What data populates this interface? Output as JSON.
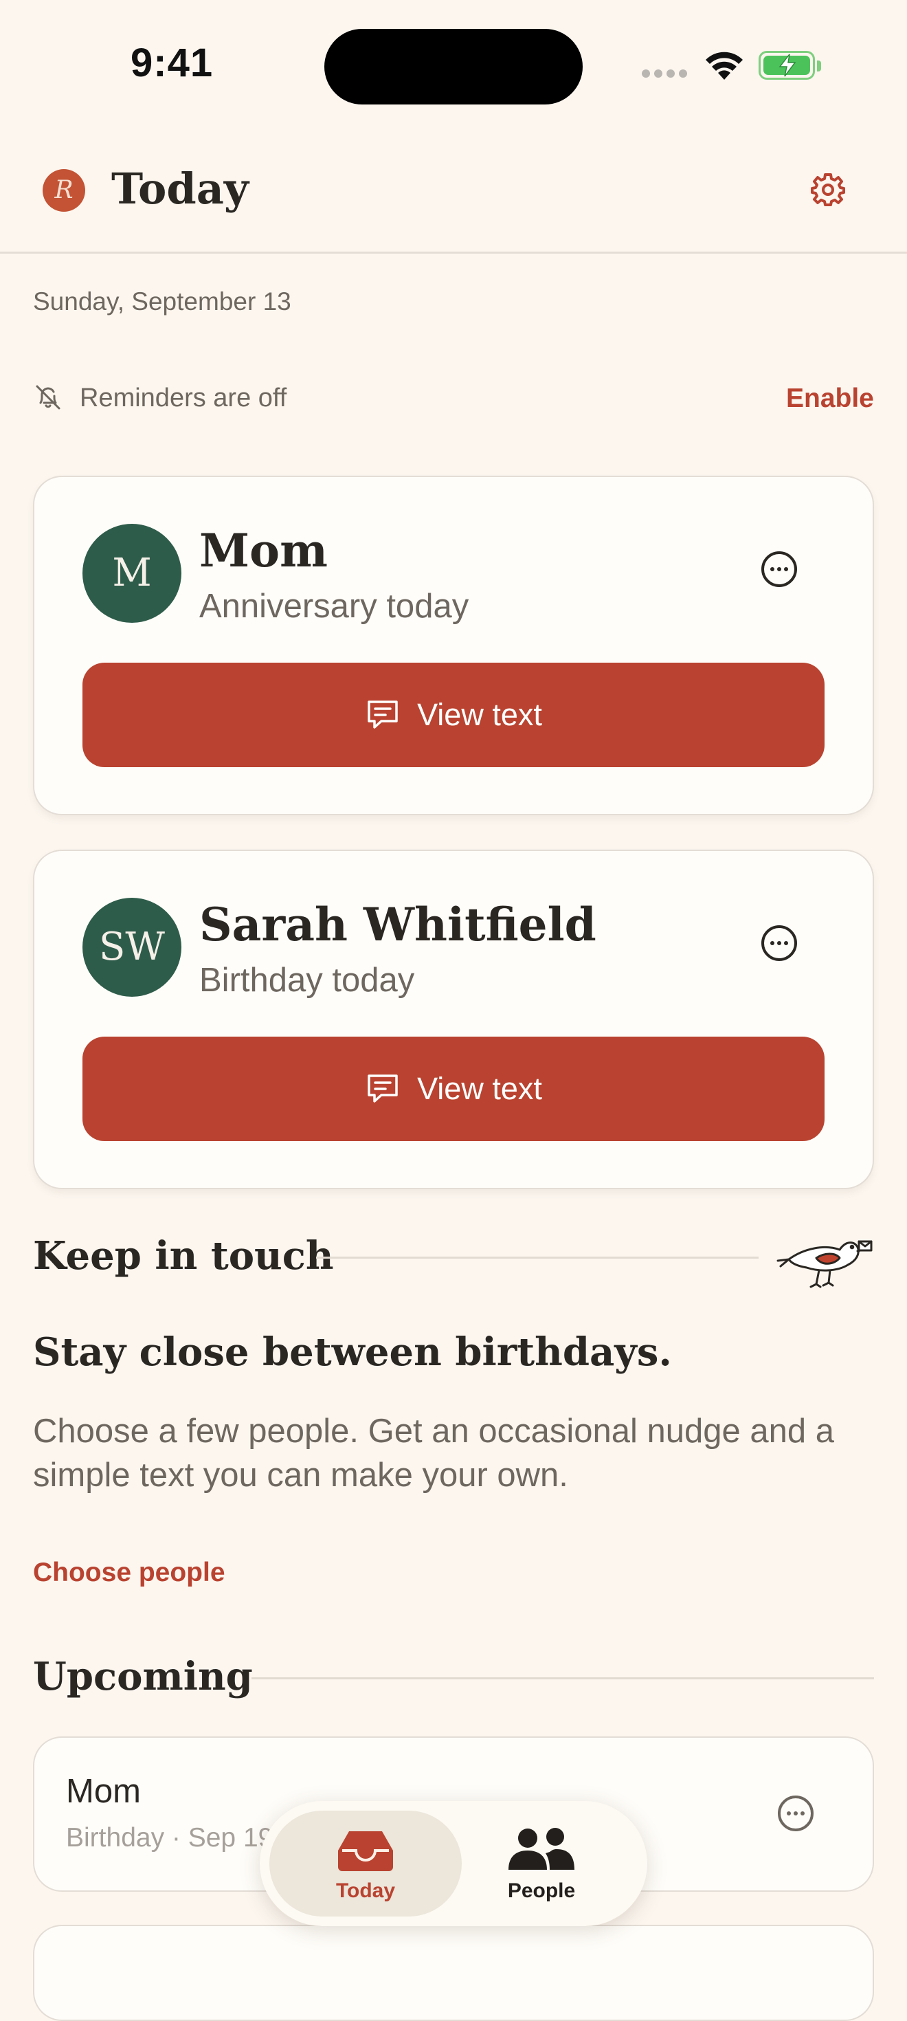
{
  "status_bar": {
    "time": "9:41"
  },
  "header": {
    "logo_letter": "R",
    "title": "Today"
  },
  "date": "Sunday, September 13",
  "reminders": {
    "text": "Reminders are off",
    "action": "Enable"
  },
  "today_cards": [
    {
      "initials": "M",
      "name": "Mom",
      "occasion": "Anniversary today",
      "button": "View text"
    },
    {
      "initials": "SW",
      "name": "Sarah Whitfield",
      "occasion": "Birthday today",
      "button": "View text"
    }
  ],
  "keep_in_touch": {
    "section_title": "Keep in touch",
    "heading": "Stay close between birthdays.",
    "body": "Choose a few people. Get an occasional nudge and a simple text you can make your own.",
    "action": "Choose people"
  },
  "upcoming": {
    "section_title": "Upcoming",
    "items": [
      {
        "name": "Mom",
        "detail": "Birthday · Sep 19"
      }
    ]
  },
  "tab_bar": {
    "tabs": [
      {
        "label": "Today",
        "active": true
      },
      {
        "label": "People",
        "active": false
      }
    ]
  },
  "colors": {
    "accent": "#b94330",
    "avatar_green": "#2e5c4b",
    "background": "#fcf6ef"
  }
}
